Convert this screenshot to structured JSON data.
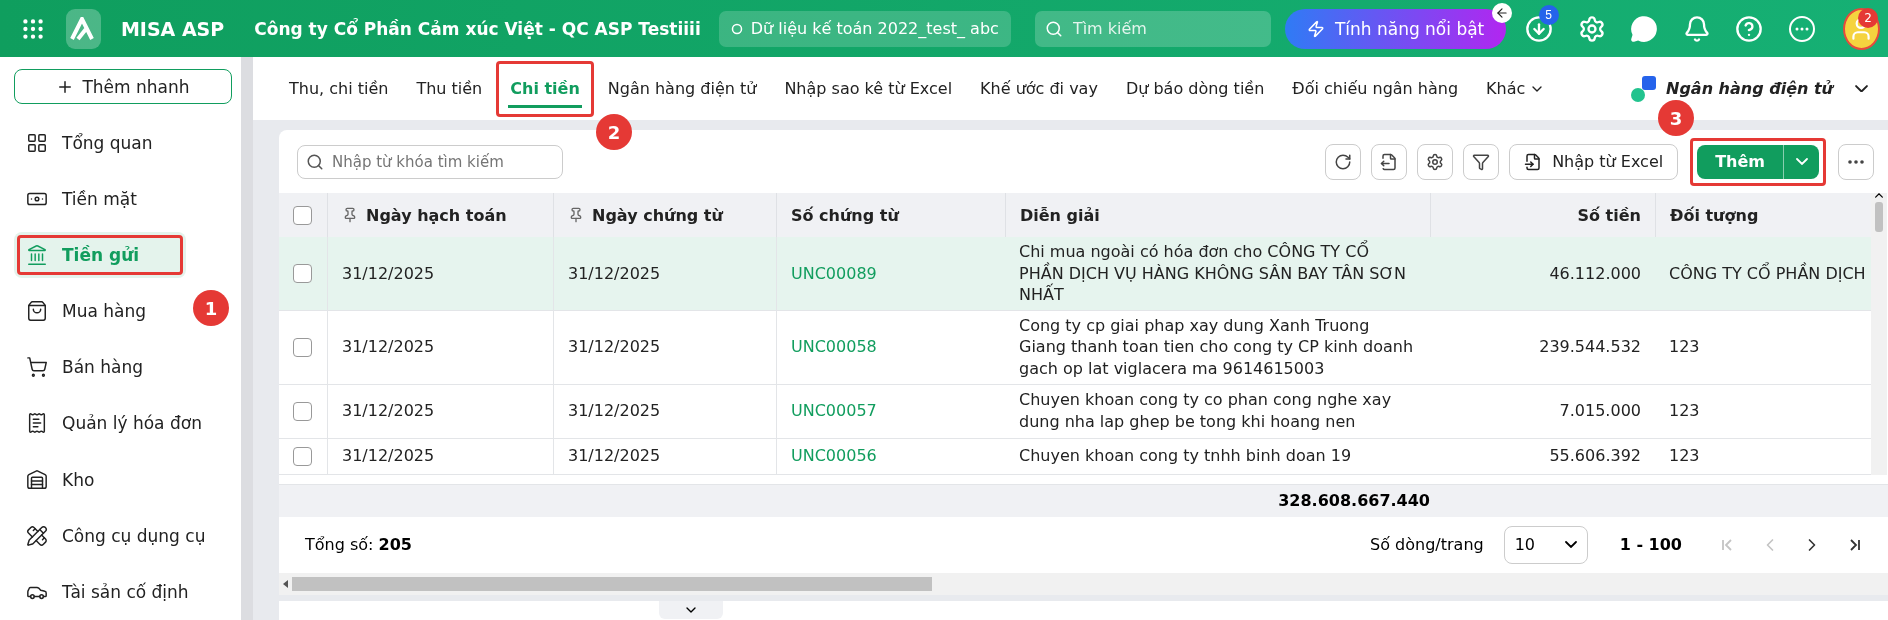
{
  "topbar": {
    "app_name": "MISA ASP",
    "company": "Công ty Cổ Phần Cảm xúc Việt - QC ASP Testiiii",
    "database": "Dữ liệu kế toán 2022_test_ abc",
    "search": {
      "placeholder": "Tìm kiếm"
    },
    "feature_button": "Tính năng nổi bật",
    "download_badge": "5",
    "avatar_badge": "2"
  },
  "sidebar": {
    "quick_add": "Thêm nhanh",
    "items": [
      {
        "kind": "overview",
        "label": "Tổng quan",
        "selected": false,
        "highlighted": false
      },
      {
        "kind": "cash",
        "label": "Tiền mặt",
        "selected": false,
        "highlighted": false
      },
      {
        "kind": "bank",
        "label": "Tiền gửi",
        "selected": true,
        "highlighted": true
      },
      {
        "kind": "purchase",
        "label": "Mua hàng",
        "selected": false,
        "highlighted": false
      },
      {
        "kind": "sales",
        "label": "Bán hàng",
        "selected": false,
        "highlighted": false
      },
      {
        "kind": "invoice",
        "label": "Quản lý hóa đơn",
        "selected": false,
        "highlighted": false
      },
      {
        "kind": "warehouse",
        "label": "Kho",
        "selected": false,
        "highlighted": false
      },
      {
        "kind": "tools",
        "label": "Công cụ dụng cụ",
        "selected": false,
        "highlighted": false
      },
      {
        "kind": "assets",
        "label": "Tài sản cố định",
        "selected": false,
        "highlighted": false
      }
    ]
  },
  "tabs": [
    {
      "label": "Thu, chi tiền",
      "selected": false,
      "highlighted": false
    },
    {
      "label": "Thu tiền",
      "selected": false,
      "highlighted": false
    },
    {
      "label": "Chi tiền",
      "selected": true,
      "highlighted": true
    },
    {
      "label": "Ngân hàng điện tử",
      "selected": false,
      "highlighted": false
    },
    {
      "label": "Nhập sao kê từ Excel",
      "selected": false,
      "highlighted": false
    },
    {
      "label": "Khế ước đi vay",
      "selected": false,
      "highlighted": false
    },
    {
      "label": "Dự báo dòng tiền",
      "selected": false,
      "highlighted": false
    },
    {
      "label": "Đối chiếu ngân hàng",
      "selected": false,
      "highlighted": false
    },
    {
      "label": "Khác",
      "selected": false,
      "highlighted": false
    }
  ],
  "bank_switcher": "Ngân hàng điện tử",
  "toolbar": {
    "search": {
      "placeholder": "Nhập từ khóa tìm kiếm"
    },
    "import_button": "Nhập từ Excel",
    "add_button": {
      "label": "Thêm",
      "highlighted": true
    }
  },
  "table": {
    "columns": [
      {
        "label": "Ngày hạch toán",
        "pinned": true,
        "kind": "date"
      },
      {
        "label": "Ngày chứng từ",
        "pinned": true,
        "kind": "date"
      },
      {
        "label": "Số chứng từ",
        "pinned": false,
        "kind": "document"
      },
      {
        "label": "Diễn giải",
        "pinned": false,
        "kind": "description"
      },
      {
        "label": "Số tiền",
        "pinned": false,
        "kind": "amount"
      },
      {
        "label": "Đối tượng",
        "pinned": false,
        "kind": "text"
      }
    ],
    "all_checked": false,
    "rows": [
      {
        "selected": true,
        "checked": false,
        "cells": [
          "31/12/2025",
          "31/12/2025",
          "UNC00089",
          "Chi mua ngoài có hóa đơn cho CÔNG TY CỔ PHẦN DỊCH VỤ HÀNG KHÔNG SÂN BAY TÂN SƠN NHẤT",
          "46.112.000",
          "CÔNG TY CỔ PHẦN DỊCH"
        ]
      },
      {
        "selected": false,
        "checked": false,
        "cells": [
          "31/12/2025",
          "31/12/2025",
          "UNC00058",
          "Cong ty cp giai phap xay dung Xanh Truong Giang thanh toan tien cho cong ty CP kinh doanh gach op lat viglacera ma 9614615003",
          "239.544.532",
          "123"
        ]
      },
      {
        "selected": false,
        "checked": false,
        "cells": [
          "31/12/2025",
          "31/12/2025",
          "UNC00057",
          "Chuyen khoan cong ty co phan cong nghe xay dung nha lap ghep be tong khi hoang nen",
          "7.015.000",
          "123"
        ]
      },
      {
        "selected": false,
        "checked": false,
        "cells": [
          "31/12/2025",
          "31/12/2025",
          "UNC00056",
          "Chuyen khoan cong ty tnhh binh doan 19",
          "55.606.392",
          "123"
        ]
      }
    ],
    "total_amount": "328.608.667.440"
  },
  "footer": {
    "total": "Tổng số: **205**",
    "page_size_label": "Số dòng/trang",
    "page_size": "10",
    "range": "1 - 100",
    "first_disabled": true,
    "prev_disabled": true,
    "next_disabled": false,
    "last_disabled": false
  },
  "annotations": [
    {
      "label": "1"
    },
    {
      "label": "2"
    },
    {
      "label": "3"
    }
  ]
}
